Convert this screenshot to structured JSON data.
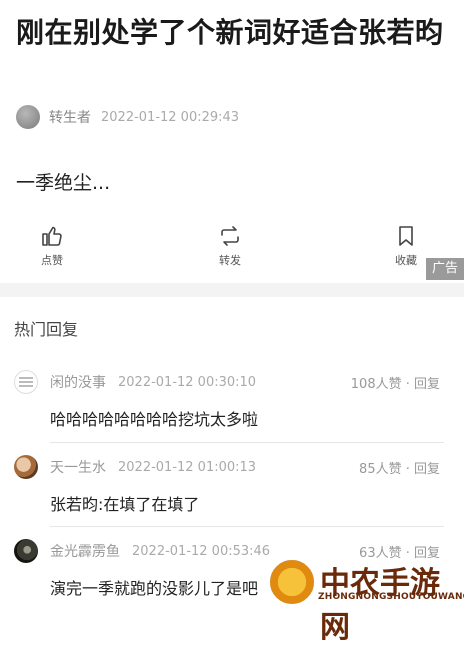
{
  "post": {
    "title": "刚在别处学了个新词好适合张若昀",
    "author": "转生者",
    "time": "2022-01-12 00:29:43",
    "body": "一季绝尘..."
  },
  "actions": {
    "like": "点赞",
    "share": "转发",
    "favorite": "收藏"
  },
  "ad_badge": "广告",
  "hot_replies": {
    "title": "热门回复",
    "items": [
      {
        "user": "闲的没事",
        "time": "2022-01-12 00:30:10",
        "stats": "108人赞 · 回复",
        "text": "哈哈哈哈哈哈哈哈挖坑太多啦"
      },
      {
        "user": "天一生水",
        "time": "2022-01-12 01:00:13",
        "stats": "85人赞 · 回复",
        "text": "张若昀:在填了在填了"
      },
      {
        "user": "金光霹雳鱼",
        "time": "2022-01-12 00:53:46",
        "stats": "63人赞 · 回复",
        "text": "演完一季就跑的没影儿了是吧"
      }
    ]
  },
  "watermark": {
    "brand": "中农手游网",
    "sub": "ZHONGNONGSHOUYOUWANG"
  }
}
